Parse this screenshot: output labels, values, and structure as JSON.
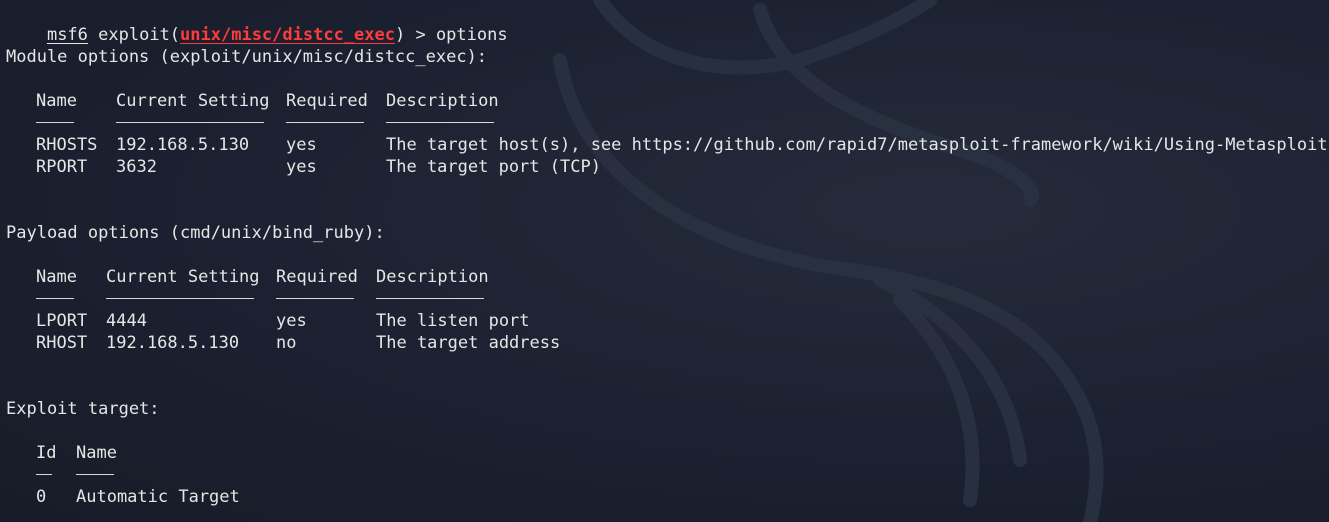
{
  "prompt": {
    "msf": "msf6",
    "exploit_prefix": "exploit(",
    "module": "unix/misc/distcc_exec",
    "suffix": ") > ",
    "command": "options"
  },
  "module_options": {
    "heading": "Module options (exploit/unix/misc/distcc_exec):",
    "headers": [
      "Name",
      "Current Setting",
      "Required",
      "Description"
    ],
    "rows": [
      [
        "RHOSTS",
        "192.168.5.130",
        "yes",
        "The target host(s), see https://github.com/rapid7/metasploit-framework/wiki/Using-Metasploit"
      ],
      [
        "RPORT",
        "3632",
        "yes",
        "The target port (TCP)"
      ]
    ]
  },
  "payload_options": {
    "heading": "Payload options (cmd/unix/bind_ruby):",
    "headers": [
      "Name",
      "Current Setting",
      "Required",
      "Description"
    ],
    "rows": [
      [
        "LPORT",
        "4444",
        "yes",
        "The listen port"
      ],
      [
        "RHOST",
        "192.168.5.130",
        "no",
        "The target address"
      ]
    ]
  },
  "exploit_target": {
    "heading": "Exploit target:",
    "headers": [
      "Id",
      "Name"
    ],
    "rows": [
      [
        "0",
        "Automatic Target"
      ]
    ]
  },
  "colors": {
    "background": "#1d2230",
    "text": "#e6e6e6",
    "module_red": "#ff3b3b"
  }
}
